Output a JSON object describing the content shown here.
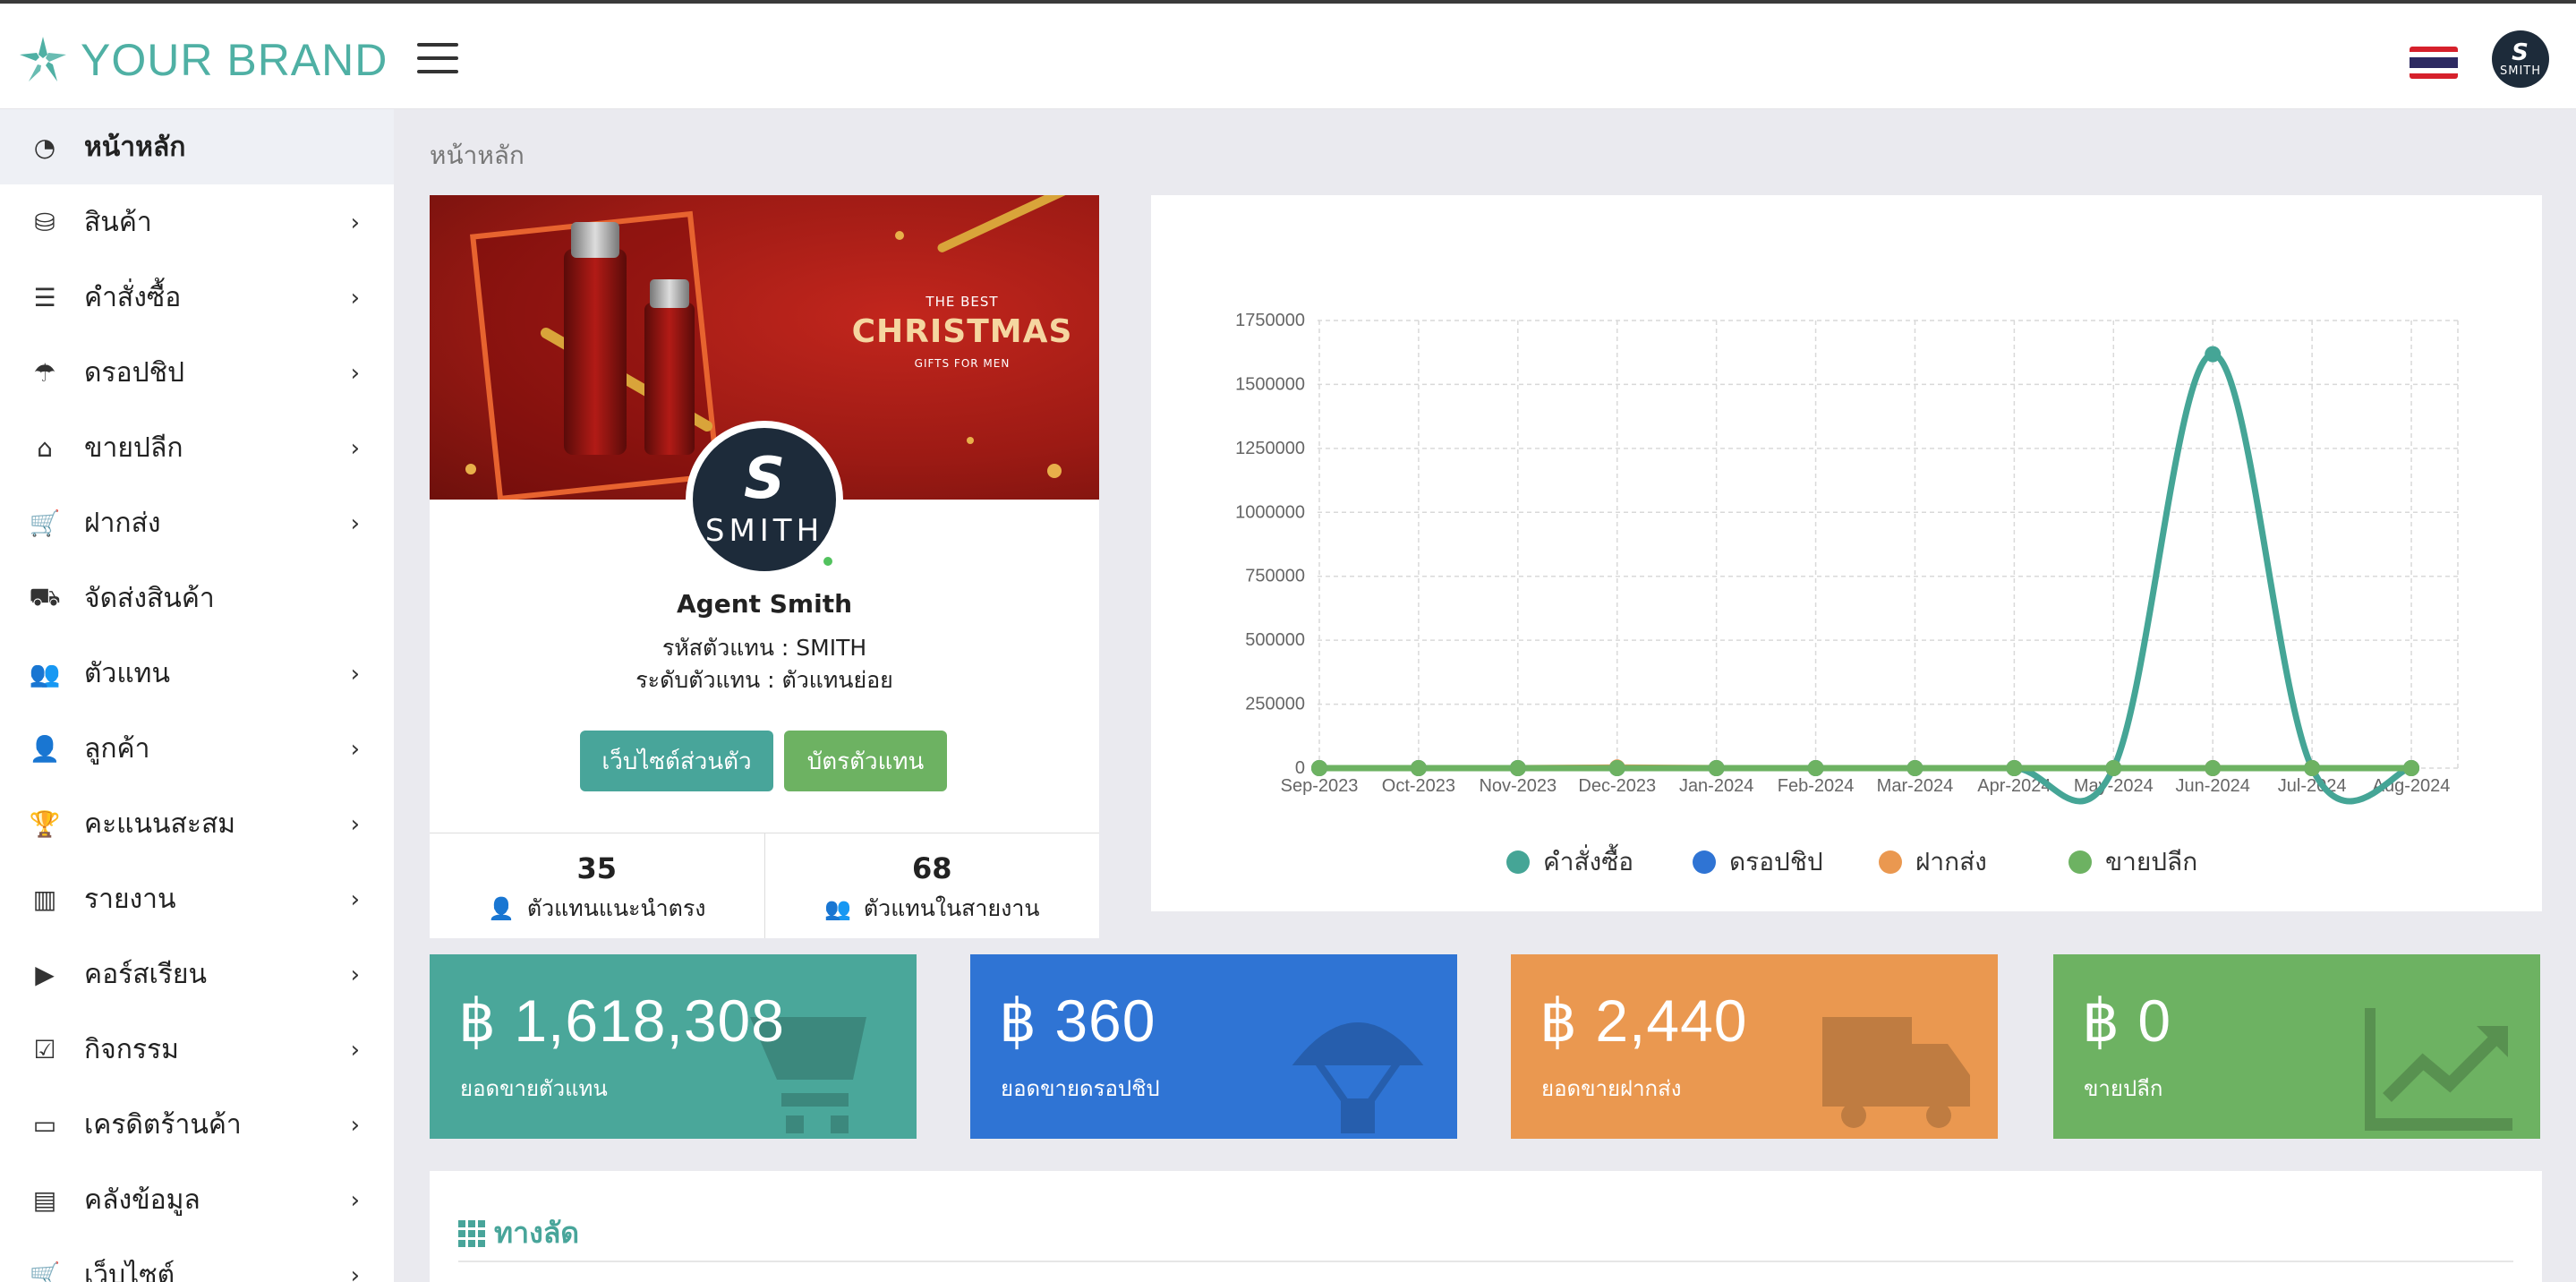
{
  "brand": {
    "name": "YOUR BRAND"
  },
  "user": {
    "avatar_text": "SMITH",
    "avatar_initial": "S"
  },
  "sidebar": {
    "items": [
      {
        "label": "หน้าหลัก",
        "icon": "dashboard-icon"
      },
      {
        "label": "สินค้า",
        "icon": "boxes-icon"
      },
      {
        "label": "คำสั่งซื้อ",
        "icon": "list-icon"
      },
      {
        "label": "ดรอปชิป",
        "icon": "parachute-icon"
      },
      {
        "label": "ขายปลีก",
        "icon": "basket-icon"
      },
      {
        "label": "ฝากส่ง",
        "icon": "cart-icon"
      },
      {
        "label": "จัดส่งสินค้า",
        "icon": "truck-icon"
      },
      {
        "label": "ตัวแทน",
        "icon": "users-icon"
      },
      {
        "label": "ลูกค้า",
        "icon": "user-friends-icon"
      },
      {
        "label": "คะแนนสะสม",
        "icon": "trophy-icon"
      },
      {
        "label": "รายงาน",
        "icon": "bar-chart-icon"
      },
      {
        "label": "คอร์สเรียน",
        "icon": "play-circle-icon"
      },
      {
        "label": "กิจกรรม",
        "icon": "calendar-check-icon"
      },
      {
        "label": "เครดิตร้านค้า",
        "icon": "money-bill-icon"
      },
      {
        "label": "คลังข้อมูล",
        "icon": "file-icon"
      },
      {
        "label": "เว็บไซต์",
        "icon": "cart-icon"
      }
    ]
  },
  "breadcrumb": "หน้าหลัก",
  "banner": {
    "line1": "THE BEST",
    "line2": "CHRISTMAS",
    "line3": "GIFTS FOR MEN"
  },
  "profile": {
    "name": "Agent Smith",
    "code_line": "รหัสตัวแทน : SMITH",
    "level_line": "ระดับตัวแทน : ตัวแทนย่อย",
    "btn_site": "เว็บไซต์ส่วนตัว",
    "btn_card": "บัตรตัวแทน",
    "stat1_value": "35",
    "stat1_label": "ตัวแทนแนะนำตรง",
    "stat2_value": "68",
    "stat2_label": "ตัวแทนในสายงาน"
  },
  "chart_data": {
    "type": "line",
    "categories": [
      "Sep-2023",
      "Oct-2023",
      "Nov-2023",
      "Dec-2023",
      "Jan-2024",
      "Feb-2024",
      "Mar-2024",
      "Apr-2024",
      "May-2024",
      "Jun-2024",
      "Jul-2024",
      "Aug-2024"
    ],
    "yticks": [
      0,
      250000,
      500000,
      750000,
      1000000,
      1250000,
      1500000,
      1750000
    ],
    "ylim": [
      0,
      1750000
    ],
    "grid": true,
    "legend_position": "bottom",
    "series": [
      {
        "name": "คำสั่งซื้อ",
        "color": "#45a596",
        "values": [
          0,
          0,
          0,
          0,
          0,
          0,
          0,
          0,
          0,
          1618308,
          0,
          0
        ]
      },
      {
        "name": "ดรอปชิป",
        "color": "#2f74d4",
        "values": [
          0,
          0,
          0,
          360,
          0,
          0,
          0,
          0,
          0,
          0,
          0,
          0
        ]
      },
      {
        "name": "ฝากส่ง",
        "color": "#ea9850",
        "values": [
          0,
          0,
          0,
          2440,
          0,
          0,
          0,
          0,
          0,
          0,
          0,
          0
        ]
      },
      {
        "name": "ขายปลีก",
        "color": "#6db262",
        "values": [
          0,
          0,
          0,
          0,
          0,
          0,
          0,
          0,
          0,
          0,
          0,
          0
        ]
      }
    ]
  },
  "tiles": [
    {
      "value": "฿ 1,618,308",
      "label": "ยอดขายตัวแทน",
      "color": "#4aa79a",
      "icon": "cart-icon"
    },
    {
      "value": "฿ 360",
      "label": "ยอดขายดรอปชิป",
      "color": "#2f74d4",
      "icon": "parachute-icon"
    },
    {
      "value": "฿ 2,440",
      "label": "ยอดขายฝากส่ง",
      "color": "#ea9850",
      "icon": "truck-icon"
    },
    {
      "value": "฿ 0",
      "label": "ขายปลีก",
      "color": "#6db262",
      "icon": "chart-line-icon"
    }
  ],
  "shortcut": {
    "title": "ทางลัด"
  }
}
